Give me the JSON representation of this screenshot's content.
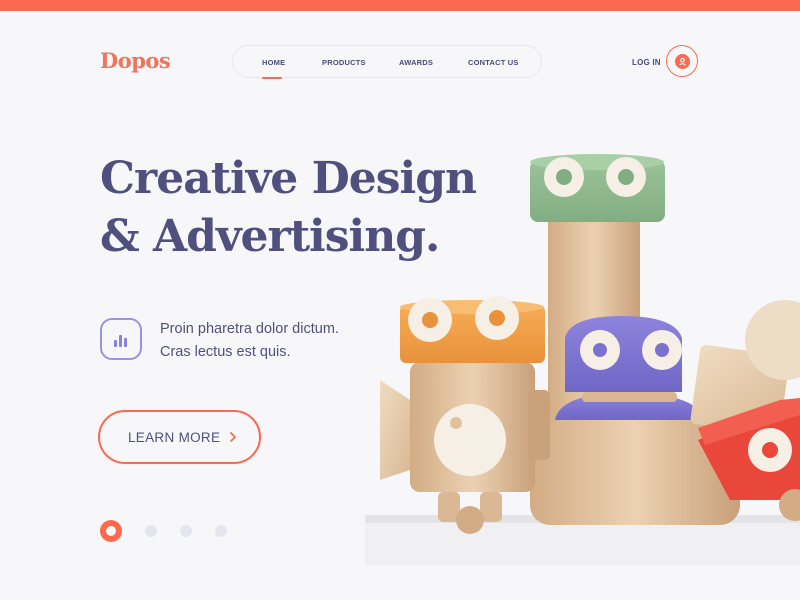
{
  "brand": {
    "logo": "Dopos"
  },
  "nav": {
    "items": [
      {
        "label": "HOME",
        "active": true
      },
      {
        "label": "PRODUCTS",
        "active": false
      },
      {
        "label": "AWARDS",
        "active": false
      },
      {
        "label": "CONTACT US",
        "active": false
      }
    ]
  },
  "header": {
    "login_label": "LOG IN",
    "user_icon": "user-icon"
  },
  "hero": {
    "headline_line1": "Creative Design",
    "headline_line2": "& Advertising.",
    "feature_icon": "bar-chart-icon",
    "feature_line1": "Proin pharetra dolor dictum.",
    "feature_line2": "Cras lectus est quis.",
    "cta_label": "LEARN MORE",
    "cta_icon": "chevron-right-icon",
    "slides": {
      "count": 4,
      "active_index": 0
    },
    "image_alt": "wooden toy robots illustration"
  },
  "colors": {
    "accent": "#fb6a4f",
    "text": "#50507e",
    "icon_purple": "#8a7fe4",
    "background": "#f7f7fa"
  }
}
